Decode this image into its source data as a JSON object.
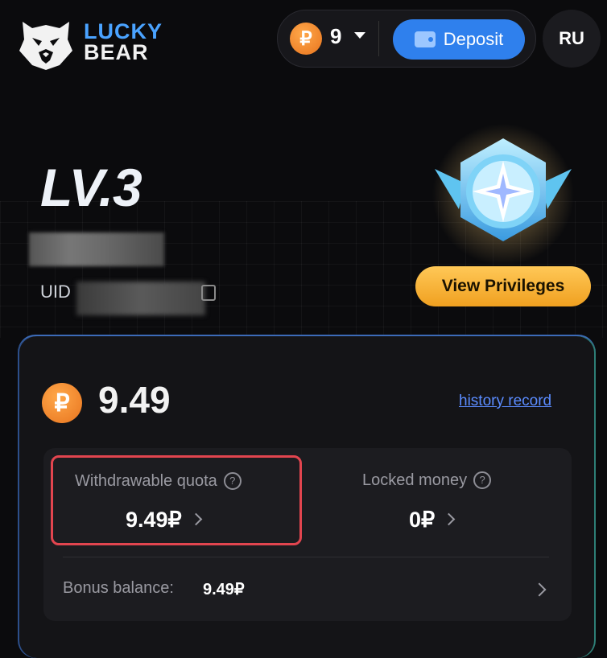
{
  "header": {
    "logo_line1": "LUCKY",
    "logo_line2": "BEAR",
    "balance": "9",
    "currency_symbol": "₽",
    "deposit_label": "Deposit",
    "language": "RU"
  },
  "profile": {
    "level": "LV.3",
    "uid_label": "UID",
    "view_privileges_label": "View Privileges"
  },
  "wallet": {
    "balance": "9.49",
    "history_link": "history record",
    "withdrawable_label": "Withdrawable quota",
    "withdrawable_value": "9.49₽",
    "locked_label": "Locked money",
    "locked_value": "0₽",
    "bonus_label": "Bonus balance:",
    "bonus_value": "9.49₽"
  },
  "colors": {
    "accent_blue": "#2f80ed",
    "coin_orange": "#ee7f25",
    "highlight_red": "#e2454f",
    "privileges_gold": "#f5b335"
  },
  "icons": [
    "bear-logo-icon",
    "ruble-coin-icon",
    "caret-down-icon",
    "wallet-icon",
    "level-badge-icon",
    "copy-icon",
    "question-icon",
    "chevron-right-icon"
  ]
}
